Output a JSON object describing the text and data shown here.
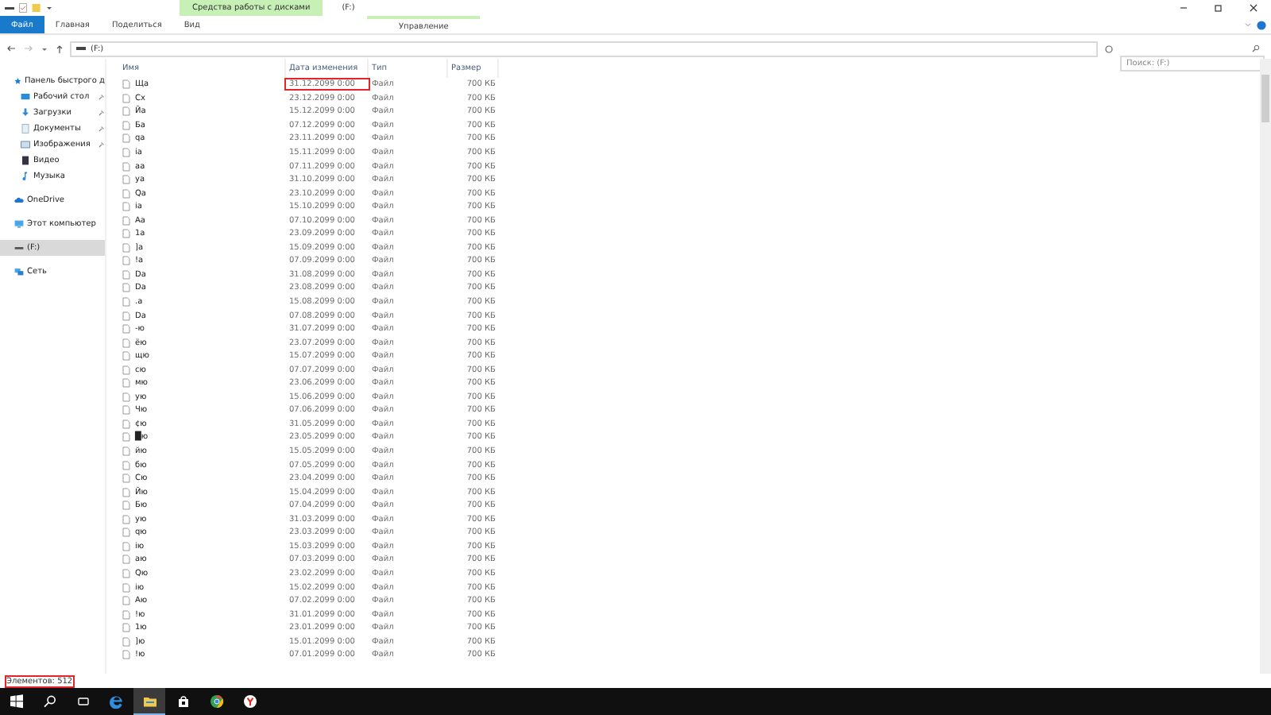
{
  "window": {
    "title": "(F:)",
    "context_group": "Средства работы с дисками"
  },
  "ribbon_tabs": [
    {
      "label": "Файл",
      "kind": "file"
    },
    {
      "label": "Главная",
      "kind": "tab"
    },
    {
      "label": "Поделиться",
      "kind": "tab"
    },
    {
      "label": "Вид",
      "kind": "tab"
    },
    {
      "label": "Управление",
      "kind": "context"
    }
  ],
  "address": {
    "path": "(F:)",
    "search_placeholder": "Поиск: (F:)"
  },
  "sidebar": {
    "items": [
      {
        "label": "Панель быстрого д",
        "kind": "star",
        "pinned": false,
        "selected": false
      },
      {
        "label": "Рабочий стол",
        "kind": "desktop",
        "pinned": true,
        "selected": false
      },
      {
        "label": "Загрузки",
        "kind": "download",
        "pinned": true,
        "selected": false
      },
      {
        "label": "Документы",
        "kind": "document",
        "pinned": true,
        "selected": false
      },
      {
        "label": "Изображения",
        "kind": "image",
        "pinned": true,
        "selected": false
      },
      {
        "label": "Видео",
        "kind": "video",
        "pinned": false,
        "selected": false
      },
      {
        "label": "Музыка",
        "kind": "music",
        "pinned": false,
        "selected": false
      },
      {
        "label": "OneDrive",
        "kind": "cloud",
        "pinned": false,
        "selected": false
      },
      {
        "label": "Этот компьютер",
        "kind": "computer",
        "pinned": false,
        "selected": false
      },
      {
        "label": "(F:)",
        "kind": "drive",
        "pinned": false,
        "selected": true
      },
      {
        "label": "Сеть",
        "kind": "network",
        "pinned": false,
        "selected": false
      }
    ]
  },
  "table": {
    "columns": [
      "Имя",
      "Дата изменения",
      "Тип",
      "Размер"
    ],
    "rows": [
      {
        "name": "Ща",
        "date": "31.12.2099 0:00",
        "type": "Файл",
        "size": "700 КБ",
        "highlighted": true
      },
      {
        "name": "Сх",
        "date": "23.12.2099 0:00",
        "type": "Файл",
        "size": "700 КБ",
        "highlighted": false
      },
      {
        "name": "Йа",
        "date": "15.12.2099 0:00",
        "type": "Файл",
        "size": "700 КБ",
        "highlighted": false
      },
      {
        "name": "Ба",
        "date": "07.12.2099 0:00",
        "type": "Файл",
        "size": "700 КБ",
        "highlighted": false
      },
      {
        "name": "qa",
        "date": "23.11.2099 0:00",
        "type": "Файл",
        "size": "700 КБ",
        "highlighted": false
      },
      {
        "name": "ia",
        "date": "15.11.2099 0:00",
        "type": "Файл",
        "size": "700 КБ",
        "highlighted": false
      },
      {
        "name": "aa",
        "date": "07.11.2099 0:00",
        "type": "Файл",
        "size": "700 КБ",
        "highlighted": false
      },
      {
        "name": "ya",
        "date": "31.10.2099 0:00",
        "type": "Файл",
        "size": "700 КБ",
        "highlighted": false
      },
      {
        "name": "Qa",
        "date": "23.10.2099 0:00",
        "type": "Файл",
        "size": "700 КБ",
        "highlighted": false
      },
      {
        "name": "ia",
        "date": "15.10.2099 0:00",
        "type": "Файл",
        "size": "700 КБ",
        "highlighted": false
      },
      {
        "name": "Aa",
        "date": "07.10.2099 0:00",
        "type": "Файл",
        "size": "700 КБ",
        "highlighted": false
      },
      {
        "name": "1a",
        "date": "23.09.2099 0:00",
        "type": "Файл",
        "size": "700 КБ",
        "highlighted": false
      },
      {
        "name": "]a",
        "date": "15.09.2099 0:00",
        "type": "Файл",
        "size": "700 КБ",
        "highlighted": false
      },
      {
        "name": "!a",
        "date": "07.09.2099 0:00",
        "type": "Файл",
        "size": "700 КБ",
        "highlighted": false
      },
      {
        "name": "Da",
        "date": "31.08.2099 0:00",
        "type": "Файл",
        "size": "700 КБ",
        "highlighted": false
      },
      {
        "name": "Da",
        "date": "23.08.2099 0:00",
        "type": "Файл",
        "size": "700 КБ",
        "highlighted": false
      },
      {
        "name": ".a",
        "date": "15.08.2099 0:00",
        "type": "Файл",
        "size": "700 КБ",
        "highlighted": false
      },
      {
        "name": "Da",
        "date": "07.08.2099 0:00",
        "type": "Файл",
        "size": "700 КБ",
        "highlighted": false
      },
      {
        "name": "-ю",
        "date": "31.07.2099 0:00",
        "type": "Файл",
        "size": "700 КБ",
        "highlighted": false
      },
      {
        "name": "ёю",
        "date": "23.07.2099 0:00",
        "type": "Файл",
        "size": "700 КБ",
        "highlighted": false
      },
      {
        "name": "щю",
        "date": "15.07.2099 0:00",
        "type": "Файл",
        "size": "700 КБ",
        "highlighted": false
      },
      {
        "name": "сю",
        "date": "07.07.2099 0:00",
        "type": "Файл",
        "size": "700 КБ",
        "highlighted": false
      },
      {
        "name": "мю",
        "date": "23.06.2099 0:00",
        "type": "Файл",
        "size": "700 КБ",
        "highlighted": false
      },
      {
        "name": "ую",
        "date": "15.06.2099 0:00",
        "type": "Файл",
        "size": "700 КБ",
        "highlighted": false
      },
      {
        "name": "Чю",
        "date": "07.06.2099 0:00",
        "type": "Файл",
        "size": "700 КБ",
        "highlighted": false
      },
      {
        "name": "¢ю",
        "date": "31.05.2099 0:00",
        "type": "Файл",
        "size": "700 КБ",
        "highlighted": false
      },
      {
        "name": "█ю",
        "date": "23.05.2099 0:00",
        "type": "Файл",
        "size": "700 КБ",
        "highlighted": false
      },
      {
        "name": "йю",
        "date": "15.05.2099 0:00",
        "type": "Файл",
        "size": "700 КБ",
        "highlighted": false
      },
      {
        "name": "бю",
        "date": "07.05.2099 0:00",
        "type": "Файл",
        "size": "700 КБ",
        "highlighted": false
      },
      {
        "name": "Сю",
        "date": "23.04.2099 0:00",
        "type": "Файл",
        "size": "700 КБ",
        "highlighted": false
      },
      {
        "name": "Йю",
        "date": "15.04.2099 0:00",
        "type": "Файл",
        "size": "700 КБ",
        "highlighted": false
      },
      {
        "name": "Бю",
        "date": "07.04.2099 0:00",
        "type": "Файл",
        "size": "700 КБ",
        "highlighted": false
      },
      {
        "name": "ую",
        "date": "31.03.2099 0:00",
        "type": "Файл",
        "size": "700 КБ",
        "highlighted": false
      },
      {
        "name": "qю",
        "date": "23.03.2099 0:00",
        "type": "Файл",
        "size": "700 КБ",
        "highlighted": false
      },
      {
        "name": "iю",
        "date": "15.03.2099 0:00",
        "type": "Файл",
        "size": "700 КБ",
        "highlighted": false
      },
      {
        "name": "aю",
        "date": "07.03.2099 0:00",
        "type": "Файл",
        "size": "700 КБ",
        "highlighted": false
      },
      {
        "name": "Qю",
        "date": "23.02.2099 0:00",
        "type": "Файл",
        "size": "700 КБ",
        "highlighted": false
      },
      {
        "name": "iю",
        "date": "15.02.2099 0:00",
        "type": "Файл",
        "size": "700 КБ",
        "highlighted": false
      },
      {
        "name": "Aю",
        "date": "07.02.2099 0:00",
        "type": "Файл",
        "size": "700 КБ",
        "highlighted": false
      },
      {
        "name": "!ю",
        "date": "31.01.2099 0:00",
        "type": "Файл",
        "size": "700 КБ",
        "highlighted": false
      },
      {
        "name": "1ю",
        "date": "23.01.2099 0:00",
        "type": "Файл",
        "size": "700 КБ",
        "highlighted": false
      },
      {
        "name": "]ю",
        "date": "15.01.2099 0:00",
        "type": "Файл",
        "size": "700 КБ",
        "highlighted": false
      },
      {
        "name": "!ю",
        "date": "07.01.2099 0:00",
        "type": "Файл",
        "size": "700 КБ",
        "highlighted": false
      }
    ]
  },
  "status_bar": {
    "text": "Элементов: 512",
    "highlighted": true
  },
  "taskbar": {
    "items": [
      {
        "kind": "start",
        "active": false
      },
      {
        "kind": "search",
        "active": false
      },
      {
        "kind": "taskview",
        "active": false
      },
      {
        "kind": "edge",
        "active": false
      },
      {
        "kind": "explorer",
        "active": true
      },
      {
        "kind": "store",
        "active": false
      },
      {
        "kind": "chrome",
        "active": false
      },
      {
        "kind": "yandex",
        "active": false
      }
    ]
  }
}
